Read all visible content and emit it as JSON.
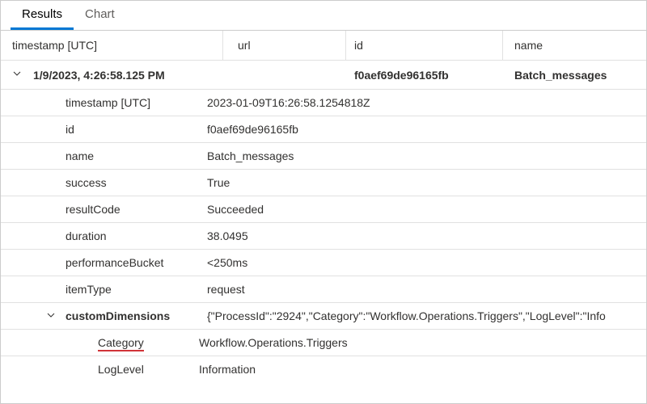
{
  "tabs": {
    "results": "Results",
    "chart": "Chart"
  },
  "columns": {
    "timestamp": "timestamp [UTC]",
    "url": "url",
    "id": "id",
    "name": "name"
  },
  "summary": {
    "timestamp": "1/9/2023, 4:26:58.125 PM",
    "url": "",
    "id": "f0aef69de96165fb",
    "name": "Batch_messages"
  },
  "details": {
    "timestamp_label": "timestamp [UTC]",
    "timestamp_value": "2023-01-09T16:26:58.1254818Z",
    "id_label": "id",
    "id_value": "f0aef69de96165fb",
    "name_label": "name",
    "name_value": "Batch_messages",
    "success_label": "success",
    "success_value": "True",
    "resultCode_label": "resultCode",
    "resultCode_value": "Succeeded",
    "duration_label": "duration",
    "duration_value": "38.0495",
    "perf_label": "performanceBucket",
    "perf_value": "<250ms",
    "itemType_label": "itemType",
    "itemType_value": "request"
  },
  "customDimensions": {
    "label": "customDimensions",
    "json": "{\"ProcessId\":\"2924\",\"Category\":\"Workflow.Operations.Triggers\",\"LogLevel\":\"Info",
    "category_label": "Category",
    "category_value": "Workflow.Operations.Triggers",
    "loglevel_label": "LogLevel",
    "loglevel_value": "Information"
  }
}
